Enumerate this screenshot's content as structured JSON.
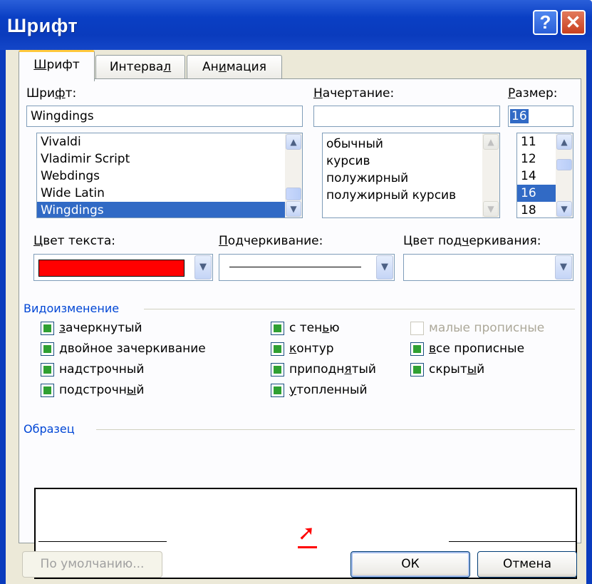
{
  "window": {
    "title": "Шрифт",
    "help_glyph": "?",
    "close_glyph": "✕"
  },
  "tabs": [
    {
      "label": "Шрифт",
      "key": "Ш"
    },
    {
      "label_pre": "Интерва",
      "key": "л",
      "label_post": ""
    },
    {
      "label_pre": "Ан",
      "key": "и",
      "label_post": "мация"
    }
  ],
  "font": {
    "label_pre": "Шри",
    "label_key": "ф",
    "label_post": "т:",
    "value": "Wingdings",
    "items": [
      "Vivaldi",
      "Vladimir Script",
      "Webdings",
      "Wide Latin",
      "Wingdings"
    ],
    "selected": "Wingdings"
  },
  "style": {
    "label_key": "Н",
    "label_post": "ачертание:",
    "value": "",
    "items": [
      "обычный",
      "курсив",
      "полужирный",
      "полужирный курсив"
    ]
  },
  "size": {
    "label_key": "Р",
    "label_post": "азмер:",
    "value": "16",
    "items": [
      "11",
      "12",
      "14",
      "16",
      "18"
    ],
    "selected": "16"
  },
  "color": {
    "label_key": "Ц",
    "label_post": "вет текста:",
    "value_color": "#ff0000"
  },
  "underline": {
    "label_key": "П",
    "label_post": "одчеркивание:"
  },
  "underline_color": {
    "label_pre": "Цвет под",
    "label_key": "ч",
    "label_post": "еркивания:"
  },
  "effects": {
    "title": "Видоизменение",
    "items": [
      {
        "pre": "",
        "key": "з",
        "post": "ачеркнутый",
        "checked": true,
        "enabled": true
      },
      {
        "pre": "",
        "key": "д",
        "post": "войное зачеркивание",
        "checked": true,
        "enabled": true
      },
      {
        "pre": "на",
        "key": "д",
        "post": "строчный",
        "checked": true,
        "enabled": true
      },
      {
        "pre": "подстрочн",
        "key": "ы",
        "post": "й",
        "checked": true,
        "enabled": true
      },
      {
        "pre": "с тен",
        "key": "ь",
        "post": "ю",
        "checked": true,
        "enabled": true
      },
      {
        "pre": "",
        "key": "к",
        "post": "онтур",
        "checked": true,
        "enabled": true
      },
      {
        "pre": "приподн",
        "key": "я",
        "post": "тый",
        "checked": true,
        "enabled": true
      },
      {
        "pre": "",
        "key": "у",
        "post": "топленный",
        "checked": true,
        "enabled": true
      },
      {
        "pre": "малые прописные",
        "key": "",
        "post": "",
        "checked": false,
        "enabled": false
      },
      {
        "pre": "",
        "key": "в",
        "post": "се прописные",
        "checked": true,
        "enabled": true
      },
      {
        "pre": "скрыт",
        "key": "ы",
        "post": "й",
        "checked": true,
        "enabled": true
      }
    ]
  },
  "sample": {
    "title": "Образец",
    "glyph": "➚",
    "color": "#ff0000"
  },
  "buttons": {
    "default": "По умолчанию...",
    "ok": "ОК",
    "cancel": "Отмена"
  },
  "colors": {
    "title_bar": "#0a3bbd",
    "selection": "#316ac5",
    "face": "#ece9d8",
    "group_title": "#0046d5",
    "check_fill": "#2fa032"
  },
  "icons": {
    "scroll_up": "chevron-up-icon",
    "scroll_down": "chevron-down-icon"
  }
}
